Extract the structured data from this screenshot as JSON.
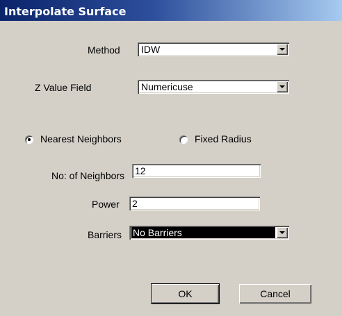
{
  "window": {
    "title": "Interpolate Surface"
  },
  "method": {
    "label": "Method",
    "value": "IDW"
  },
  "z_value_field": {
    "label": "Z Value Field",
    "value": "Numericuse"
  },
  "mode": {
    "nearest_label": "Nearest Neighbors",
    "fixed_label": "Fixed Radius",
    "selected": "Nearest Neighbors"
  },
  "neighbors": {
    "label": "No: of Neighbors",
    "value": "12"
  },
  "power": {
    "label": "Power",
    "value": "2"
  },
  "barriers": {
    "label": "Barriers",
    "value": "No Barriers"
  },
  "buttons": {
    "ok": "OK",
    "cancel": "Cancel"
  }
}
